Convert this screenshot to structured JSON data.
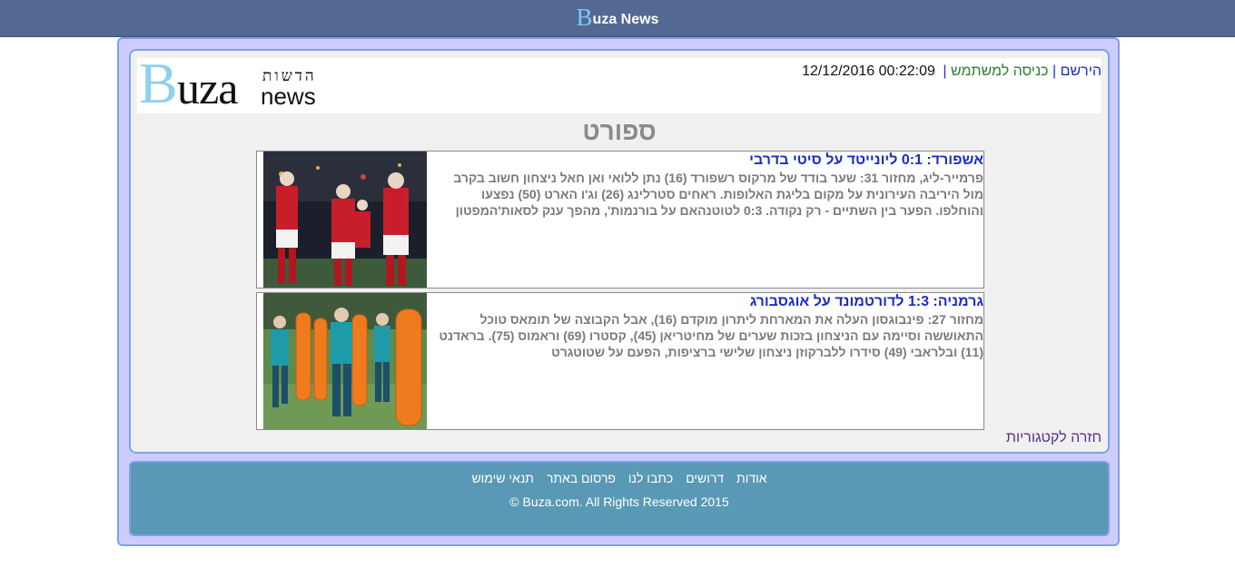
{
  "topbar": {
    "brand_initial": "B",
    "brand_rest": "uza News"
  },
  "logo": {
    "letter": "B",
    "uza": "uza",
    "hebrew": "הדשות",
    "news": "news"
  },
  "top_links": {
    "register": "הירשם",
    "separator": "|",
    "login": "כניסה למשתמש",
    "datetime": "12/12/2016 00:22:09"
  },
  "section_title": "ספורט",
  "articles": [
    {
      "headline": "אשפורד: 0:1 ליונייטד על סיטי בדרבי",
      "summary": "פרמייר-ליג, מחזור 31: שער בודד של מרקוס רשפורד (16) נתן ללואי ואן חאל ניצחון חשוב בקרב מול היריבה העירונית על מקום בליגת האלופות. ראחים סטרלינג (26) וג'ו הארט (50) נפצעו והוחלפו. הפער בין השתיים - רק נקודה. 0:3 לטוטנהאם על בורנמות', מהפך ענק לסאות'המפטון"
    },
    {
      "headline": "גרמניה: 1:3 לדורטמונד על אוגסבורג",
      "summary": "מחזור 27: פינבוגסון העלה את המארחת ליתרון מוקדם (16), אבל הקבוצה של תומאס טוכל התאוששה וסיימה עם הניצחון בזכות שערים של מחיטריאן (45), קסטרו (69) וראמוס (75). בראדנט (11) ובלראבי (49) סידרו ללברקוזן ניצחון שלישי ברציפות, הפעם על שטוטגרט"
    }
  ],
  "back_link": "חזרה לקטגוריות",
  "footer": {
    "nav": [
      "אודות",
      "דרושים",
      "כתבו לנו",
      "פרסום באתר",
      "תנאי שימוש"
    ],
    "copyright": "© Buza.com. All Rights Reserved 2015"
  }
}
